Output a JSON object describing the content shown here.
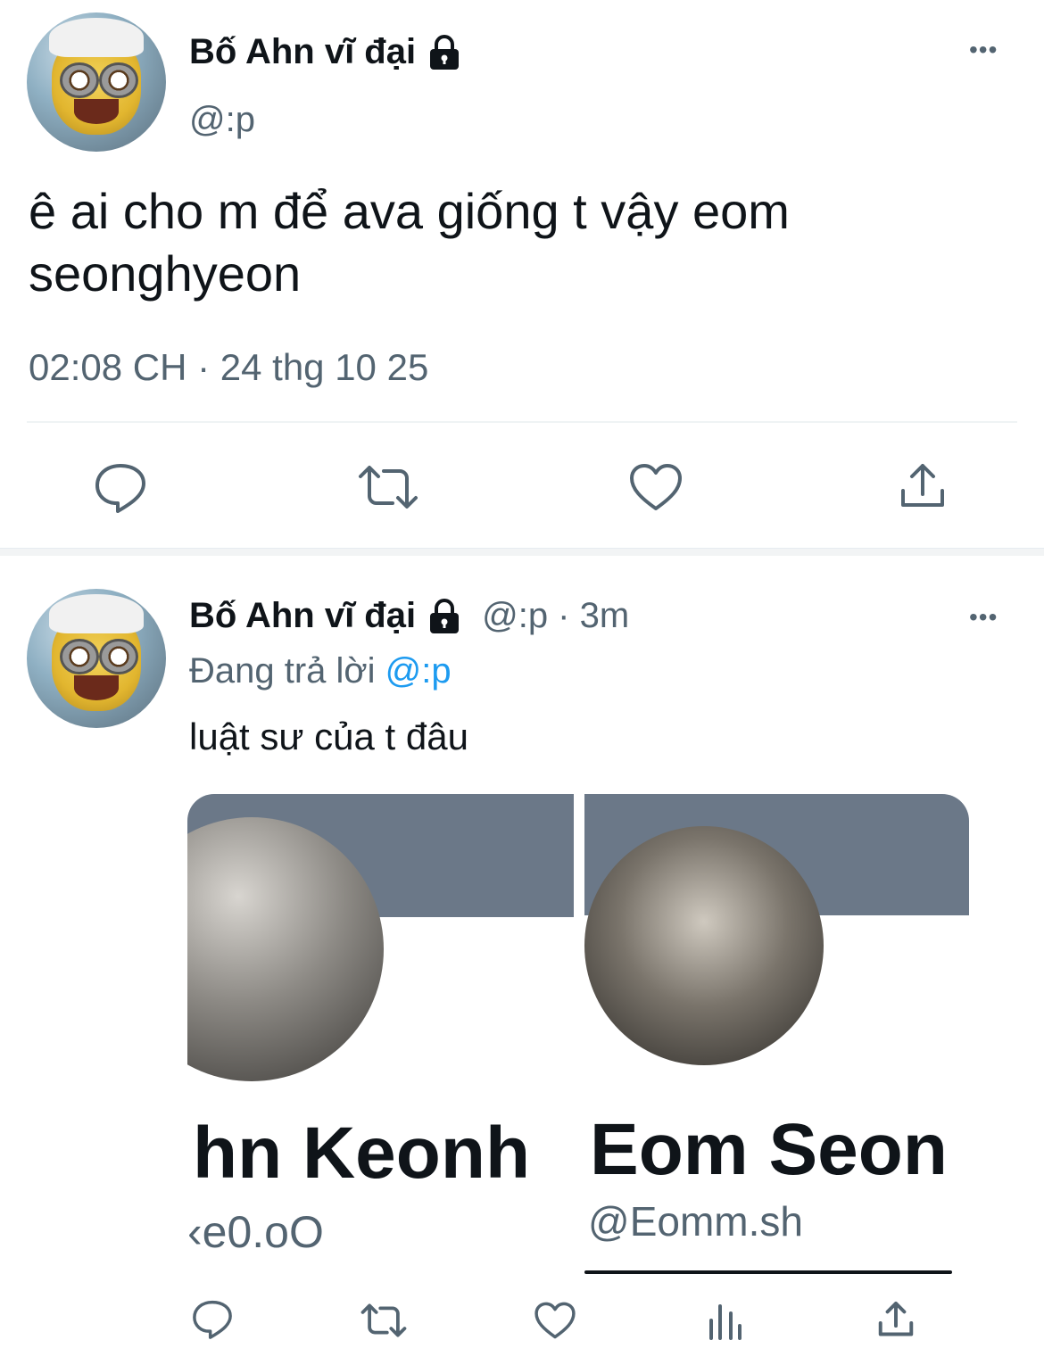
{
  "tweet_main": {
    "display_name": "Bố Ahn vĩ đại",
    "handle": "@:p",
    "text_line1": "ê ai cho m để ava giống t vậy eom",
    "text_line2": "seonghyeon",
    "timestamp": "02:08 CH · 24 thg 10 25",
    "more_label": "•••"
  },
  "reply": {
    "display_name": "Bố Ahn vĩ đại",
    "meta": "@:p · 3m",
    "replying_prefix": "Đang trả lời",
    "replying_to": "@:p",
    "text": "luật sư của t đâu",
    "more_label": "•••",
    "images": [
      {
        "name_fragment": "hn Keonh",
        "handle_fragment": "‹e0.oO"
      },
      {
        "name_fragment": "Eom Seon",
        "handle_fragment": "@Eomm.sh"
      }
    ]
  },
  "icons": [
    "reply-icon",
    "retweet-icon",
    "like-icon",
    "share-icon",
    "analytics-icon",
    "lock-icon"
  ],
  "colors": {
    "text": "#0f1419",
    "muted": "#536471",
    "link": "#1d9bf0",
    "banner": "#6b7888"
  }
}
